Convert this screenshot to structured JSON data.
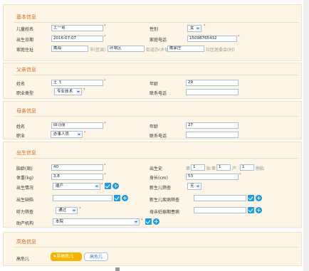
{
  "basic": {
    "title": "基本信息",
    "child_name_label": "儿童姓名",
    "child_name": "王一诺",
    "gender_label": "性别",
    "gender": "女",
    "birth_date_label": "出生日期",
    "birth_date": "2016-07-07",
    "phone_label": "家庭电话",
    "phone": "15098765432",
    "address_label": "家庭住址",
    "city": "威海",
    "city_suffix": "市(区县)",
    "district": "环翠区",
    "district_suffix": "街道办(乡镇)",
    "community": "威家庄",
    "community_suffix": "社区居委会(村)"
  },
  "father": {
    "title": "父亲信息",
    "name_label": "姓名",
    "name": "王飞",
    "age_label": "年龄",
    "age": "29",
    "occupation_label": "职业类型",
    "occupation": "专业技术",
    "phone_label": "联系电话",
    "phone": ""
  },
  "mother": {
    "title": "母亲信息",
    "name_label": "姓名",
    "name": "田马丽",
    "age_label": "年龄",
    "age": "27",
    "occupation_label": "职业",
    "occupation": "办事人员",
    "phone_label": "联系电话",
    "phone": ""
  },
  "birth": {
    "title": "出生信息",
    "gest_label": "胎龄(周)",
    "gest": "40",
    "history_label": "出生史",
    "history_g_label": "第",
    "history_g": "1",
    "history_g_unit": "胎",
    "history_g2_label": "第",
    "history_p": "1",
    "history_p_unit": "产",
    "history_c": "1",
    "history_c_unit": "胞胎",
    "weight_label": "体重(kg)",
    "weight": "3.8",
    "length_label": "身长(cm)",
    "length": "53",
    "situation_label": "出生情况",
    "situation": "顺产",
    "screening_label": "新生儿筛查",
    "screening": "无",
    "defect_label": "出生缺陷",
    "defect": "",
    "newborn_disease_label": "新生儿疾病筛查",
    "newborn_disease": "",
    "hearing_label": "听力筛查",
    "hearing": "通过",
    "mother_disease_label": "母亲妊娠期患病",
    "mother_disease": "",
    "agency_label": "助产机构",
    "agency": "本院"
  },
  "risk": {
    "title": "高危信息",
    "label": "高危儿",
    "option_non": "非高危儿",
    "option_high": "高危儿"
  },
  "colors": {
    "section_title": "#d2691e",
    "panel_bg": "#fdf5e6",
    "accent_blue": "#1c9be8",
    "chip_selected": "#f5b400"
  }
}
